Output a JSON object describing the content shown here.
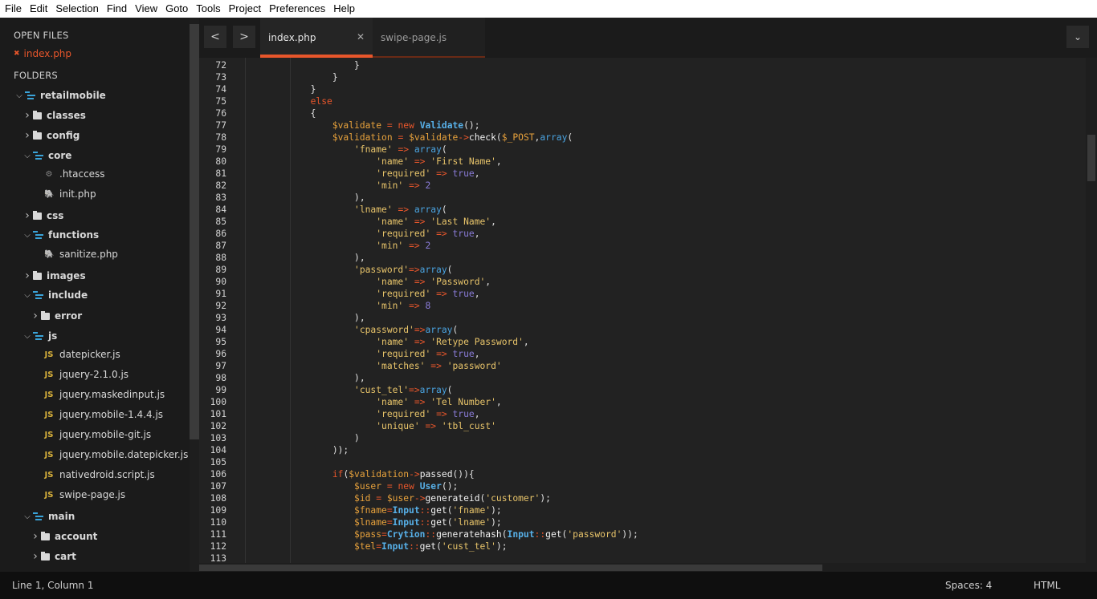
{
  "menu": [
    "File",
    "Edit",
    "Selection",
    "Find",
    "View",
    "Goto",
    "Tools",
    "Project",
    "Preferences",
    "Help"
  ],
  "sidebar": {
    "open_files_heading": "OPEN FILES",
    "open_file": "index.php",
    "open_file_close": "✖",
    "folders_heading": "FOLDERS",
    "tree": [
      {
        "label": "retailmobile",
        "type": "open-folder",
        "bold": true
      },
      {
        "label": "classes",
        "type": "closed-folder",
        "bold": true
      },
      {
        "label": "config",
        "type": "closed-folder",
        "bold": true
      },
      {
        "label": "core",
        "type": "open-folder",
        "bold": true
      },
      {
        "label": ".htaccess",
        "type": "gear-file"
      },
      {
        "label": "init.php",
        "type": "php-file"
      },
      {
        "label": "css",
        "type": "closed-folder",
        "bold": true
      },
      {
        "label": "functions",
        "type": "open-folder",
        "bold": true
      },
      {
        "label": "sanitize.php",
        "type": "php-file"
      },
      {
        "label": "images",
        "type": "closed-folder",
        "bold": true
      },
      {
        "label": "include",
        "type": "open-folder",
        "bold": true
      },
      {
        "label": "error",
        "type": "closed-folder",
        "bold": true
      },
      {
        "label": "js",
        "type": "open-folder",
        "bold": true
      },
      {
        "label": "datepicker.js",
        "type": "js-file"
      },
      {
        "label": "jquery-2.1.0.js",
        "type": "js-file"
      },
      {
        "label": "jquery.maskedinput.js",
        "type": "js-file"
      },
      {
        "label": "jquery.mobile-1.4.4.js",
        "type": "js-file"
      },
      {
        "label": "jquery.mobile-git.js",
        "type": "js-file"
      },
      {
        "label": "jquery.mobile.datepicker.js",
        "type": "js-file"
      },
      {
        "label": "nativedroid.script.js",
        "type": "js-file"
      },
      {
        "label": "swipe-page.js",
        "type": "js-file"
      },
      {
        "label": "main",
        "type": "open-folder",
        "bold": true
      },
      {
        "label": "account",
        "type": "closed-folder",
        "bold": true
      },
      {
        "label": "cart",
        "type": "closed-folder",
        "bold": true
      }
    ],
    "js_icon": "JS",
    "php_icon": "🐘",
    "gear_icon": "⚙"
  },
  "tabs": {
    "prev": "<",
    "next": ">",
    "active": "index.php",
    "inactive": "swipe-page.js",
    "close": "✕",
    "dropdown": "⌄"
  },
  "editor": {
    "lines": [
      {
        "n": "72",
        "t": [
          [
            "",
            "                    }"
          ]
        ]
      },
      {
        "n": "73",
        "t": [
          [
            "",
            "                }"
          ]
        ]
      },
      {
        "n": "74",
        "t": [
          [
            "",
            "            }"
          ]
        ]
      },
      {
        "n": "75",
        "t": [
          [
            "k",
            "            else"
          ]
        ]
      },
      {
        "n": "76",
        "t": [
          [
            "",
            "            {"
          ]
        ]
      },
      {
        "n": "77",
        "t": [
          [
            "v",
            "                $validate"
          ],
          [
            "",
            " "
          ],
          [
            "k",
            "="
          ],
          [
            "",
            " "
          ],
          [
            "k",
            "new"
          ],
          [
            "",
            " "
          ],
          [
            "c",
            "Validate"
          ],
          [
            "",
            "();"
          ]
        ]
      },
      {
        "n": "78",
        "t": [
          [
            "v",
            "                $validation"
          ],
          [
            "",
            " "
          ],
          [
            "k",
            "="
          ],
          [
            "",
            " "
          ],
          [
            "v",
            "$validate"
          ],
          [
            "k",
            "->"
          ],
          [
            "f",
            "check"
          ],
          [
            "",
            "("
          ],
          [
            "v",
            "$_POST"
          ],
          [
            "",
            ","
          ],
          [
            "a",
            "array"
          ],
          [
            "",
            "("
          ]
        ]
      },
      {
        "n": "79",
        "t": [
          [
            "s",
            "                    'fname'"
          ],
          [
            "",
            " "
          ],
          [
            "k",
            "=>"
          ],
          [
            "",
            " "
          ],
          [
            "a",
            "array"
          ],
          [
            "",
            "("
          ]
        ]
      },
      {
        "n": "80",
        "t": [
          [
            "s",
            "                        'name'"
          ],
          [
            "",
            " "
          ],
          [
            "k",
            "=>"
          ],
          [
            "",
            " "
          ],
          [
            "s",
            "'First Name'"
          ],
          [
            "",
            ","
          ]
        ]
      },
      {
        "n": "81",
        "t": [
          [
            "s",
            "                        'required'"
          ],
          [
            "",
            " "
          ],
          [
            "k",
            "=>"
          ],
          [
            "",
            " "
          ],
          [
            "n",
            "true"
          ],
          [
            "",
            ","
          ]
        ]
      },
      {
        "n": "82",
        "t": [
          [
            "s",
            "                        'min'"
          ],
          [
            "",
            " "
          ],
          [
            "k",
            "=>"
          ],
          [
            "",
            " "
          ],
          [
            "n",
            "2"
          ]
        ]
      },
      {
        "n": "83",
        "t": [
          [
            "",
            "                    ),"
          ]
        ]
      },
      {
        "n": "84",
        "t": [
          [
            "s",
            "                    'lname'"
          ],
          [
            "",
            " "
          ],
          [
            "k",
            "=>"
          ],
          [
            "",
            " "
          ],
          [
            "a",
            "array"
          ],
          [
            "",
            "("
          ]
        ]
      },
      {
        "n": "85",
        "t": [
          [
            "s",
            "                        'name'"
          ],
          [
            "",
            " "
          ],
          [
            "k",
            "=>"
          ],
          [
            "",
            " "
          ],
          [
            "s",
            "'Last Name'"
          ],
          [
            "",
            ","
          ]
        ]
      },
      {
        "n": "86",
        "t": [
          [
            "s",
            "                        'required'"
          ],
          [
            "",
            " "
          ],
          [
            "k",
            "=>"
          ],
          [
            "",
            " "
          ],
          [
            "n",
            "true"
          ],
          [
            "",
            ","
          ]
        ]
      },
      {
        "n": "87",
        "t": [
          [
            "s",
            "                        'min'"
          ],
          [
            "",
            " "
          ],
          [
            "k",
            "=>"
          ],
          [
            "",
            " "
          ],
          [
            "n",
            "2"
          ]
        ]
      },
      {
        "n": "88",
        "t": [
          [
            "",
            "                    ),"
          ]
        ]
      },
      {
        "n": "89",
        "t": [
          [
            "s",
            "                    'password'"
          ],
          [
            "k",
            "=>"
          ],
          [
            "a",
            "array"
          ],
          [
            "",
            "("
          ]
        ]
      },
      {
        "n": "90",
        "t": [
          [
            "s",
            "                        'name'"
          ],
          [
            "",
            " "
          ],
          [
            "k",
            "=>"
          ],
          [
            "",
            " "
          ],
          [
            "s",
            "'Password'"
          ],
          [
            "",
            ","
          ]
        ]
      },
      {
        "n": "91",
        "t": [
          [
            "s",
            "                        'required'"
          ],
          [
            "",
            " "
          ],
          [
            "k",
            "=>"
          ],
          [
            "",
            " "
          ],
          [
            "n",
            "true"
          ],
          [
            "",
            ","
          ]
        ]
      },
      {
        "n": "92",
        "t": [
          [
            "s",
            "                        'min'"
          ],
          [
            "",
            " "
          ],
          [
            "k",
            "=>"
          ],
          [
            "",
            " "
          ],
          [
            "n",
            "8"
          ]
        ]
      },
      {
        "n": "93",
        "t": [
          [
            "",
            "                    ),"
          ]
        ]
      },
      {
        "n": "94",
        "t": [
          [
            "s",
            "                    'cpassword'"
          ],
          [
            "k",
            "=>"
          ],
          [
            "a",
            "array"
          ],
          [
            "",
            "("
          ]
        ]
      },
      {
        "n": "95",
        "t": [
          [
            "s",
            "                        'name'"
          ],
          [
            "",
            " "
          ],
          [
            "k",
            "=>"
          ],
          [
            "",
            " "
          ],
          [
            "s",
            "'Retype Password'"
          ],
          [
            "",
            ","
          ]
        ]
      },
      {
        "n": "96",
        "t": [
          [
            "s",
            "                        'required'"
          ],
          [
            "",
            " "
          ],
          [
            "k",
            "=>"
          ],
          [
            "",
            " "
          ],
          [
            "n",
            "true"
          ],
          [
            "",
            ","
          ]
        ]
      },
      {
        "n": "97",
        "t": [
          [
            "s",
            "                        'matches'"
          ],
          [
            "",
            " "
          ],
          [
            "k",
            "=>"
          ],
          [
            "",
            " "
          ],
          [
            "s",
            "'password'"
          ]
        ]
      },
      {
        "n": "98",
        "t": [
          [
            "",
            "                    ),"
          ]
        ]
      },
      {
        "n": "99",
        "t": [
          [
            "s",
            "                    'cust_tel'"
          ],
          [
            "k",
            "=>"
          ],
          [
            "a",
            "array"
          ],
          [
            "",
            "("
          ]
        ]
      },
      {
        "n": "100",
        "t": [
          [
            "s",
            "                        'name'"
          ],
          [
            "",
            " "
          ],
          [
            "k",
            "=>"
          ],
          [
            "",
            " "
          ],
          [
            "s",
            "'Tel Number'"
          ],
          [
            "",
            ","
          ]
        ]
      },
      {
        "n": "101",
        "t": [
          [
            "s",
            "                        'required'"
          ],
          [
            "",
            " "
          ],
          [
            "k",
            "=>"
          ],
          [
            "",
            " "
          ],
          [
            "n",
            "true"
          ],
          [
            "",
            ","
          ]
        ]
      },
      {
        "n": "102",
        "t": [
          [
            "s",
            "                        'unique'"
          ],
          [
            "",
            " "
          ],
          [
            "k",
            "=>"
          ],
          [
            "",
            " "
          ],
          [
            "s",
            "'tbl_cust'"
          ]
        ]
      },
      {
        "n": "103",
        "t": [
          [
            "",
            "                    )"
          ]
        ]
      },
      {
        "n": "104",
        "t": [
          [
            "",
            "                ));"
          ]
        ]
      },
      {
        "n": "105",
        "t": [
          [
            "",
            ""
          ]
        ]
      },
      {
        "n": "106",
        "t": [
          [
            "k",
            "                if"
          ],
          [
            "",
            "("
          ],
          [
            "v",
            "$validation"
          ],
          [
            "k",
            "->"
          ],
          [
            "f",
            "passed"
          ],
          [
            "",
            "()){"
          ]
        ]
      },
      {
        "n": "107",
        "t": [
          [
            "v",
            "                    $user"
          ],
          [
            "",
            " "
          ],
          [
            "k",
            "="
          ],
          [
            "",
            " "
          ],
          [
            "k",
            "new"
          ],
          [
            "",
            " "
          ],
          [
            "c",
            "User"
          ],
          [
            "",
            "();"
          ]
        ]
      },
      {
        "n": "108",
        "t": [
          [
            "v",
            "                    $id"
          ],
          [
            "",
            " "
          ],
          [
            "k",
            "="
          ],
          [
            "",
            " "
          ],
          [
            "v",
            "$user"
          ],
          [
            "k",
            "->"
          ],
          [
            "f",
            "generateid"
          ],
          [
            "",
            "("
          ],
          [
            "s",
            "'customer'"
          ],
          [
            "",
            "); "
          ]
        ]
      },
      {
        "n": "109",
        "t": [
          [
            "v",
            "                    $fname"
          ],
          [
            "k",
            "="
          ],
          [
            "c",
            "Input"
          ],
          [
            "k",
            "::"
          ],
          [
            "f",
            "get"
          ],
          [
            "",
            "("
          ],
          [
            "s",
            "'fname'"
          ],
          [
            "",
            ");"
          ]
        ]
      },
      {
        "n": "110",
        "t": [
          [
            "v",
            "                    $lname"
          ],
          [
            "k",
            "="
          ],
          [
            "c",
            "Input"
          ],
          [
            "k",
            "::"
          ],
          [
            "f",
            "get"
          ],
          [
            "",
            "("
          ],
          [
            "s",
            "'lname'"
          ],
          [
            "",
            ");"
          ]
        ]
      },
      {
        "n": "111",
        "t": [
          [
            "v",
            "                    $pass"
          ],
          [
            "k",
            "="
          ],
          [
            "c",
            "Crytion"
          ],
          [
            "k",
            "::"
          ],
          [
            "f",
            "generatehash"
          ],
          [
            "",
            "("
          ],
          [
            "c",
            "Input"
          ],
          [
            "k",
            "::"
          ],
          [
            "f",
            "get"
          ],
          [
            "",
            "("
          ],
          [
            "s",
            "'password'"
          ],
          [
            "",
            "));"
          ]
        ]
      },
      {
        "n": "112",
        "t": [
          [
            "v",
            "                    $tel"
          ],
          [
            "k",
            "="
          ],
          [
            "c",
            "Input"
          ],
          [
            "k",
            "::"
          ],
          [
            "f",
            "get"
          ],
          [
            "",
            "("
          ],
          [
            "s",
            "'cust_tel'"
          ],
          [
            "",
            ");"
          ]
        ]
      },
      {
        "n": "113",
        "t": [
          [
            "",
            ""
          ]
        ]
      }
    ]
  },
  "status": {
    "position": "Line 1, Column 1",
    "spaces": "Spaces: 4",
    "syntax": "HTML"
  },
  "colors": {
    "accent": "#e8562b",
    "keyword": "#e8562b",
    "variable": "#e8a23c",
    "string": "#e8c46a",
    "class": "#57b0e8",
    "number": "#8a7cd8"
  }
}
